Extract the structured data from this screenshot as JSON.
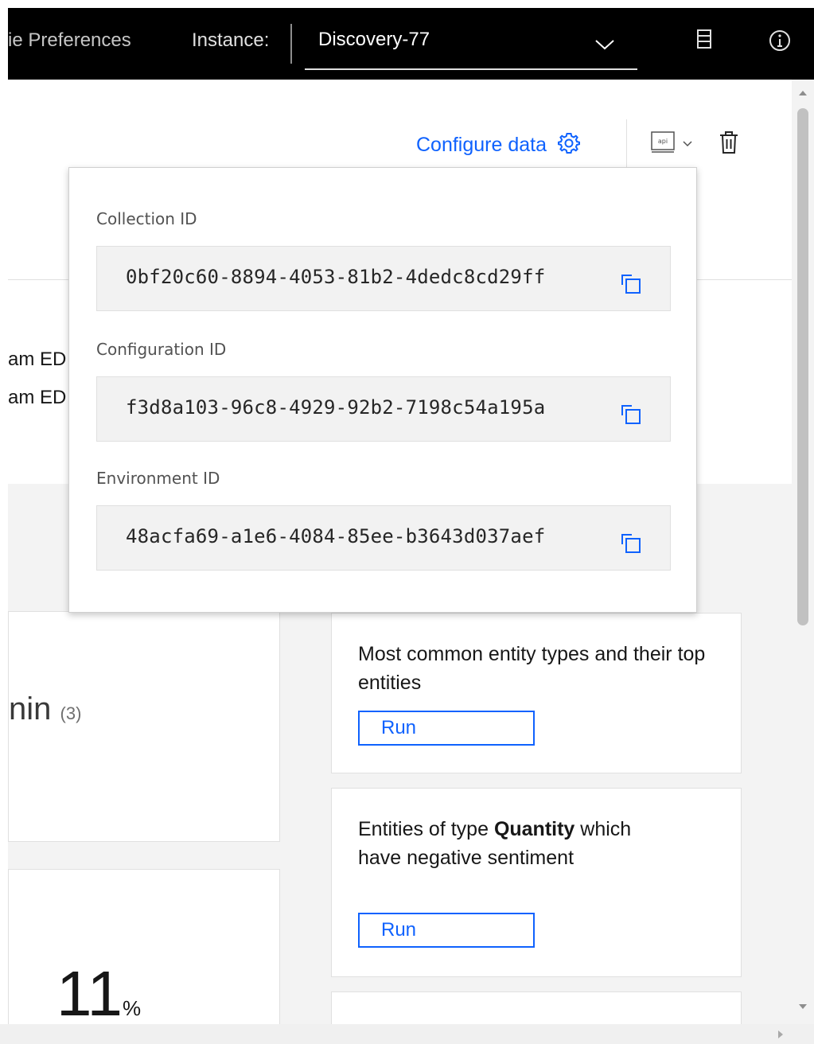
{
  "header": {
    "preferences_partial": "ie Preferences",
    "instance_label": "Instance:",
    "instance_value": "Discovery-77",
    "icons": [
      "chevron-down-icon",
      "database-icon",
      "info-icon"
    ]
  },
  "toolbar": {
    "configure_data": "Configure data",
    "api_label": "api"
  },
  "background": {
    "truncated_line_1": "am ED",
    "truncated_line_2": "am ED",
    "card_text": "nin",
    "card_count": "(3)",
    "percent_value": "11",
    "percent_unit": "%"
  },
  "queries": [
    {
      "text": "Most common entity types and their top entities",
      "run": "Run"
    },
    {
      "text_before": "Entities of type ",
      "text_bold": "Quantity",
      "text_after": " which have negative sentiment",
      "run": "Run"
    }
  ],
  "popover": {
    "collection_label": "Collection ID",
    "collection_value": "0bf20c60-8894-4053-81b2-4dedc8cd29ff",
    "configuration_label": "Configuration ID",
    "configuration_value": "f3d8a103-96c8-4929-92b2-7198c54a195a",
    "environment_label": "Environment ID",
    "environment_value": "48acfa69-a1e6-4084-85ee-b3643d037aef"
  },
  "colors": {
    "accent": "#0f62fe",
    "topbar": "#000000"
  }
}
